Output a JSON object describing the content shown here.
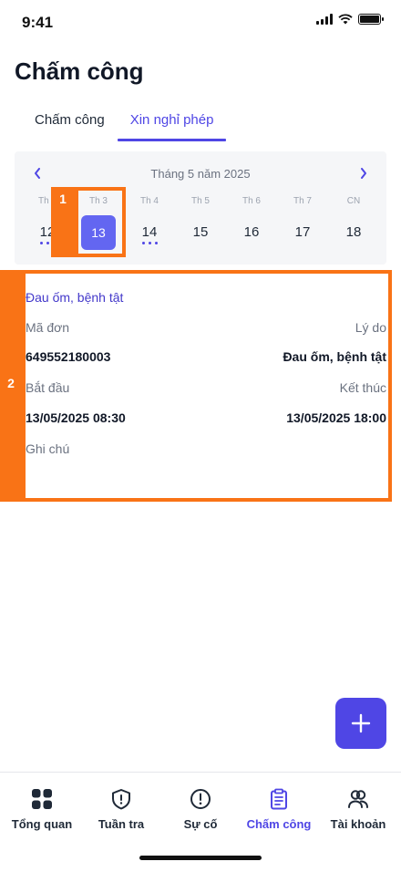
{
  "status_bar": {
    "time": "9:41"
  },
  "page": {
    "title": "Chấm công"
  },
  "tabs": [
    {
      "label": "Chấm công",
      "active": false
    },
    {
      "label": "Xin nghỉ phép",
      "active": true
    }
  ],
  "calendar": {
    "month_label": "Tháng 5 năm 2025",
    "days": [
      {
        "name": "Th 2",
        "num": "12",
        "has_dots": true,
        "selected": false
      },
      {
        "name": "Th 3",
        "num": "13",
        "has_dots": false,
        "selected": true
      },
      {
        "name": "Th 4",
        "num": "14",
        "has_dots": true,
        "selected": false
      },
      {
        "name": "Th 5",
        "num": "15",
        "has_dots": false,
        "selected": false
      },
      {
        "name": "Th 6",
        "num": "16",
        "has_dots": false,
        "selected": false
      },
      {
        "name": "Th 7",
        "num": "17",
        "has_dots": false,
        "selected": false
      },
      {
        "name": "CN",
        "num": "18",
        "has_dots": false,
        "selected": false
      }
    ]
  },
  "leave_detail": {
    "type": "Đau ốm, bệnh tật",
    "code_label": "Mã đơn",
    "reason_label": "Lý do",
    "code_value": "649552180003",
    "reason_value": "Đau ốm, bệnh tật",
    "start_label": "Bắt đầu",
    "end_label": "Kết thúc",
    "start_value": "13/05/2025 08:30",
    "end_value": "13/05/2025 18:00",
    "notes_label": "Ghi chú"
  },
  "annotations": [
    "1",
    "2"
  ],
  "bottom_nav": [
    {
      "label": "Tổng quan",
      "icon": "grid-icon",
      "active": false
    },
    {
      "label": "Tuần tra",
      "icon": "shield-icon",
      "active": false
    },
    {
      "label": "Sự cố",
      "icon": "alert-circle-icon",
      "active": false
    },
    {
      "label": "Chấm công",
      "icon": "clipboard-icon",
      "active": true
    },
    {
      "label": "Tài khoản",
      "icon": "users-icon",
      "active": false
    }
  ],
  "colors": {
    "accent": "#4f46e5",
    "selected_day": "#6366f1",
    "annotation": "#f97316"
  }
}
